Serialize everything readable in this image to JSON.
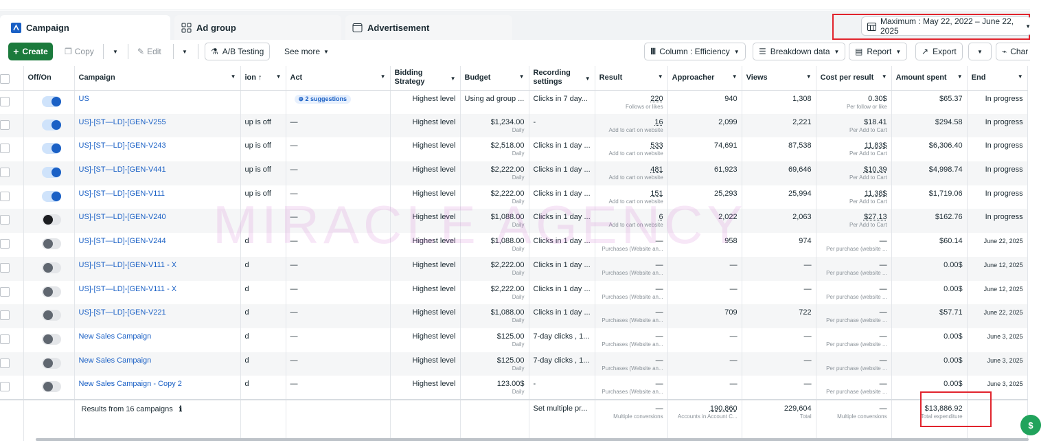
{
  "tabs": [
    {
      "label": "Campaign",
      "icon": "campaign-icon"
    },
    {
      "label": "Ad group",
      "icon": "ad-group-icon"
    },
    {
      "label": "Advertisement",
      "icon": "advertisement-icon"
    }
  ],
  "date_range": "Maximum : May 22, 2022 – June 22, 2025",
  "toolbar": {
    "create": "Create",
    "copy": "Copy",
    "edit": "Edit",
    "ab_testing": "A/B Testing",
    "see_more": "See more",
    "column": "Column : Efficiency",
    "breakdown": "Breakdown data",
    "report": "Report",
    "export": "Export",
    "chart": "Char"
  },
  "columns": {
    "offon": "Off/On",
    "campaign": "Campaign",
    "delivery": "ion ↑",
    "act": "Act",
    "bidding": "Bidding Strategy",
    "budget": "Budget",
    "recording": "Recording settings",
    "result": "Result",
    "approacher": "Approacher",
    "views": "Views",
    "cpr": "Cost per result",
    "spent": "Amount spent",
    "end": "End"
  },
  "rows": [
    {
      "toggle": "on",
      "campaign": "US",
      "delivery": "",
      "act": "2 suggestions",
      "bidding": "Highest level",
      "budget": "Using ad group ...",
      "budget_sub": "",
      "recording": "Clicks in 7 day...",
      "result": "220",
      "result_sub": "Follows or likes",
      "approacher": "940",
      "views": "1,308",
      "cpr": "0.30$",
      "cpr_sub": "Per follow or like",
      "spent": "$65.37",
      "end": "In progress"
    },
    {
      "toggle": "on",
      "campaign": "US]-[ST—LD]-[GEN-V255",
      "delivery": "up is off",
      "act": "—",
      "bidding": "Highest level",
      "budget": "$1,234.00",
      "budget_sub": "Daily",
      "recording": "-",
      "result": "16",
      "result_sub": "Add to cart on website",
      "approacher": "2,099",
      "views": "2,221",
      "cpr": "$18.41",
      "cpr_sub": "Per Add to Cart",
      "spent": "$294.58",
      "end": "In progress"
    },
    {
      "toggle": "on",
      "campaign": "US]-[ST—LD]-[GEN-V243",
      "delivery": "up is off",
      "act": "—",
      "bidding": "Highest level",
      "budget": "$2,518.00",
      "budget_sub": "Daily",
      "recording": "Clicks in 1 day ...",
      "result": "533",
      "result_sub": "Add to cart on website",
      "approacher": "74,691",
      "views": "87,538",
      "cpr": "11.83$",
      "cpr_sub": "Per Add to Cart",
      "spent": "$6,306.40",
      "end": "In progress"
    },
    {
      "toggle": "on",
      "campaign": "US]-[ST—LD]-[GEN-V441",
      "delivery": "up is off",
      "act": "—",
      "bidding": "Highest level",
      "budget": "$2,222.00",
      "budget_sub": "Daily",
      "recording": "Clicks in 1 day ...",
      "result": "481",
      "result_sub": "Add to cart on website",
      "approacher": "61,923",
      "views": "69,646",
      "cpr": "$10.39",
      "cpr_sub": "Per Add to Cart",
      "spent": "$4,998.74",
      "end": "In progress"
    },
    {
      "toggle": "on",
      "campaign": "US]-[ST—LD]-[GEN-V111",
      "delivery": "up is off",
      "act": "—",
      "bidding": "Highest level",
      "budget": "$2,222.00",
      "budget_sub": "Daily",
      "recording": "Clicks in 1 day ...",
      "result": "151",
      "result_sub": "Add to cart on website",
      "approacher": "25,293",
      "views": "25,994",
      "cpr": "11.38$",
      "cpr_sub": "Per Add to Cart",
      "spent": "$1,719.06",
      "end": "In progress"
    },
    {
      "toggle": "offdark",
      "campaign": "US]-[ST—LD]-[GEN-V240",
      "delivery": "",
      "act": "—",
      "bidding": "Highest level",
      "budget": "$1,088.00",
      "budget_sub": "Daily",
      "recording": "Clicks in 1 day ...",
      "result": "6",
      "result_sub": "Add to cart on website",
      "approacher": "2,022",
      "views": "2,063",
      "cpr": "$27.13",
      "cpr_sub": "Per Add to Cart",
      "spent": "$162.76",
      "end": "In progress"
    },
    {
      "toggle": "off",
      "campaign": "US]-[ST—LD]-[GEN-V244",
      "delivery": "d",
      "act": "—",
      "bidding": "Highest level",
      "budget": "$1,088.00",
      "budget_sub": "Daily",
      "recording": "Clicks in 1 day ...",
      "result": "—",
      "result_sub": "Purchases (Website an...",
      "approacher": "958",
      "views": "974",
      "cpr": "—",
      "cpr_sub": "Per purchase (website ...",
      "spent": "$60.14",
      "end": "June 22, 2025"
    },
    {
      "toggle": "off",
      "campaign": "US]-[ST—LD]-[GEN-V111 - X",
      "delivery": "d",
      "act": "—",
      "bidding": "Highest level",
      "budget": "$2,222.00",
      "budget_sub": "Daily",
      "recording": "Clicks in 1 day ...",
      "result": "—",
      "result_sub": "Purchases (Website an...",
      "approacher": "—",
      "views": "—",
      "cpr": "—",
      "cpr_sub": "Per purchase (website ...",
      "spent": "0.00$",
      "end": "June 12, 2025"
    },
    {
      "toggle": "off",
      "campaign": "US]-[ST—LD]-[GEN-V111 - X",
      "delivery": "d",
      "act": "—",
      "bidding": "Highest level",
      "budget": "$2,222.00",
      "budget_sub": "Daily",
      "recording": "Clicks in 1 day ...",
      "result": "—",
      "result_sub": "Purchases (Website an...",
      "approacher": "—",
      "views": "—",
      "cpr": "—",
      "cpr_sub": "Per purchase (website ...",
      "spent": "0.00$",
      "end": "June 12, 2025"
    },
    {
      "toggle": "off",
      "campaign": "US]-[ST—LD]-[GEN-V221",
      "delivery": "d",
      "act": "—",
      "bidding": "Highest level",
      "budget": "$1,088.00",
      "budget_sub": "Daily",
      "recording": "Clicks in 1 day ...",
      "result": "—",
      "result_sub": "Purchases (Website an...",
      "approacher": "709",
      "views": "722",
      "cpr": "—",
      "cpr_sub": "Per purchase (website ...",
      "spent": "$57.71",
      "end": "June 22, 2025"
    },
    {
      "toggle": "off",
      "campaign": "New Sales Campaign",
      "delivery": "d",
      "act": "—",
      "bidding": "Highest level",
      "budget": "$125.00",
      "budget_sub": "Daily",
      "recording": "7-day clicks , 1...",
      "result": "—",
      "result_sub": "Purchases (Website an...",
      "approacher": "—",
      "views": "—",
      "cpr": "—",
      "cpr_sub": "Per purchase (website ...",
      "spent": "0.00$",
      "end": "June 3, 2025"
    },
    {
      "toggle": "off",
      "campaign": "New Sales Campaign",
      "delivery": "d",
      "act": "—",
      "bidding": "Highest level",
      "budget": "$125.00",
      "budget_sub": "Daily",
      "recording": "7-day clicks , 1...",
      "result": "—",
      "result_sub": "Purchases (Website an...",
      "approacher": "—",
      "views": "—",
      "cpr": "—",
      "cpr_sub": "Per purchase (website ...",
      "spent": "0.00$",
      "end": "June 3, 2025"
    },
    {
      "toggle": "off",
      "campaign": "New Sales Campaign - Copy 2",
      "delivery": "d",
      "act": "—",
      "bidding": "Highest level",
      "budget": "123.00$",
      "budget_sub": "Daily",
      "recording": "-",
      "result": "—",
      "result_sub": "Purchases (Website an...",
      "approacher": "—",
      "views": "—",
      "cpr": "—",
      "cpr_sub": "Per purchase (website ...",
      "spent": "0.00$",
      "end": "June 3, 2025"
    }
  ],
  "footer": {
    "campaign": "Results from 16 campaigns",
    "recording": "Set multiple pr...",
    "result": "—",
    "result_sub": "Multiple conversions",
    "approacher": "190,860",
    "approacher_sub": "Accounts in Account C...",
    "views": "229,604",
    "views_sub": "Total",
    "cpr": "—",
    "cpr_sub": "Multiple conversions",
    "spent": "$13,886.92",
    "spent_sub": "Total expenditure"
  },
  "watermark": "MIRACLE AGENCY",
  "colors": {
    "accent": "#1a60c5",
    "create": "#1b7a3c",
    "highlight": "#e1232c"
  }
}
